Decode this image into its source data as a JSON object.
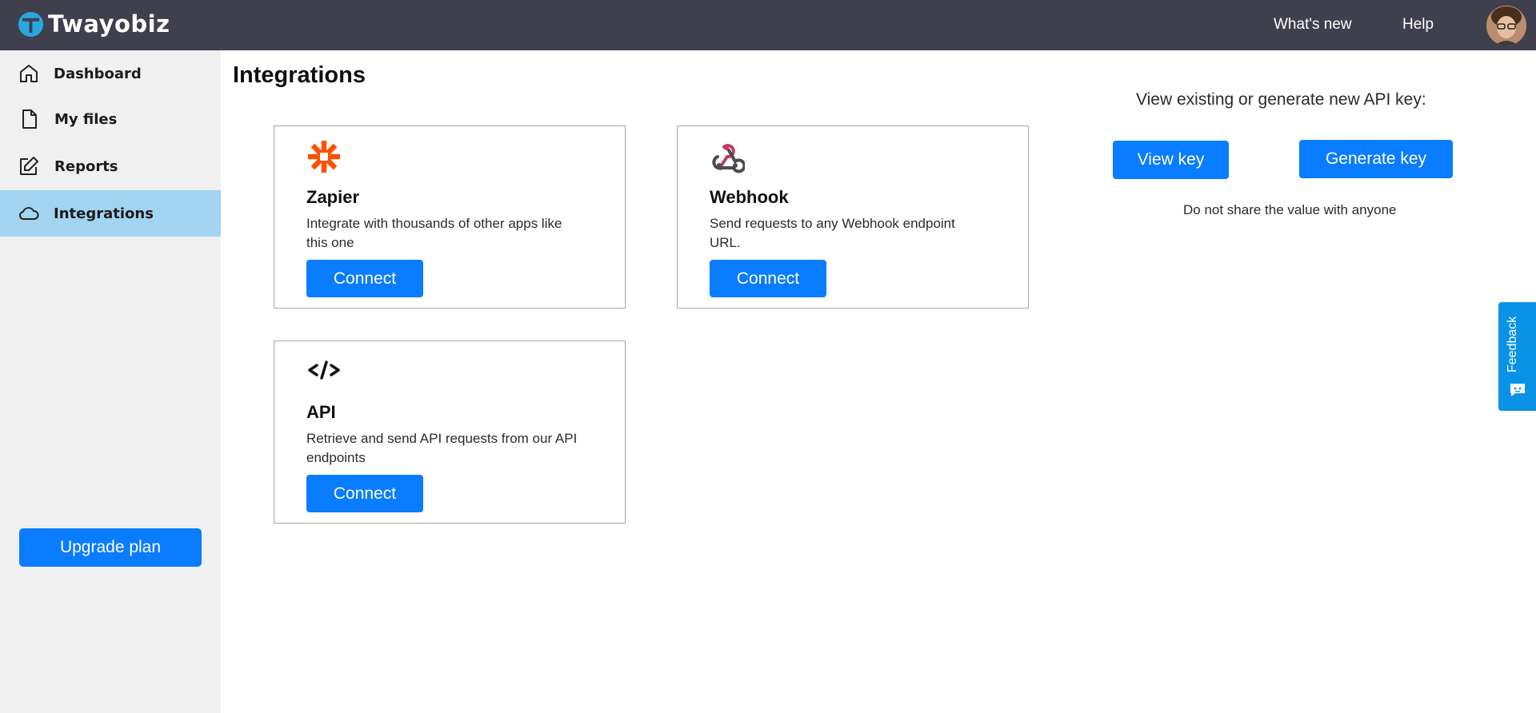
{
  "header": {
    "brand_name": "Twayobiz",
    "links": {
      "whats_new": "What's new",
      "help": "Help"
    }
  },
  "sidebar": {
    "items": [
      {
        "label": "Dashboard",
        "icon": "home-icon"
      },
      {
        "label": "My files",
        "icon": "file-icon"
      },
      {
        "label": "Reports",
        "icon": "edit-icon"
      },
      {
        "label": "Integrations",
        "icon": "cloud-icon",
        "active": true
      }
    ],
    "upgrade_label": "Upgrade plan"
  },
  "main": {
    "title": "Integrations",
    "cards": [
      {
        "title": "Zapier",
        "description": "Integrate with thousands of other apps like this one",
        "button": "Connect",
        "icon": "zapier-icon"
      },
      {
        "title": "Webhook",
        "description": "Send requests to any Webhook endpoint URL.",
        "button": "Connect",
        "icon": "webhook-icon"
      },
      {
        "title": "API",
        "description": "Retrieve and send API requests from our API endpoints",
        "button": "Connect",
        "icon": "code-icon"
      }
    ]
  },
  "api_key": {
    "prompt": "View existing or generate new API key:",
    "view_label": "View key",
    "generate_label": "Generate key",
    "warning": "Do not share the value with anyone"
  },
  "feedback": {
    "label": "Feedback"
  },
  "colors": {
    "topbar": "#3f3f4d",
    "accent": "#0a7cff",
    "active_nav": "#a3d4f0",
    "sidebar": "#f0f0f0",
    "zapier": "#ff4f00",
    "feedback": "#0a92e6"
  }
}
